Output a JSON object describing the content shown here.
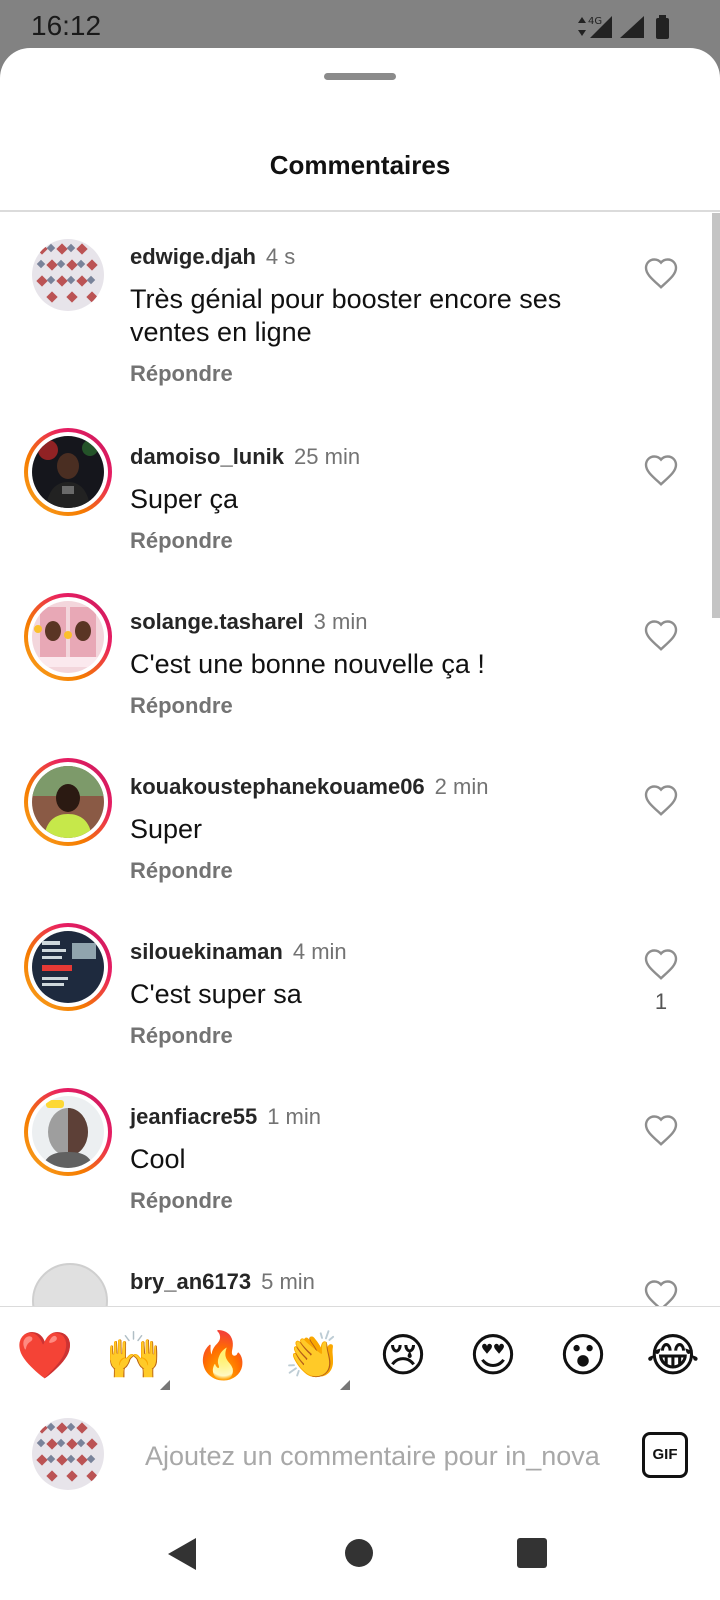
{
  "status_bar": {
    "time": "16:12",
    "network": "4G"
  },
  "sheet": {
    "title": "Commentaires"
  },
  "comments": [
    {
      "username": "edwige.djah",
      "time": "4 s",
      "text": "Très génial pour booster encore ses ventes en ligne",
      "reply": "Répondre",
      "likes": ""
    },
    {
      "username": "damoiso_lunik",
      "time": "25 min",
      "text": "Super ça",
      "reply": "Répondre",
      "likes": ""
    },
    {
      "username": "solange.tasharel",
      "time": "3 min",
      "text": "C'est une bonne nouvelle ça !",
      "reply": "Répondre",
      "likes": ""
    },
    {
      "username": "kouakoustephanekouame06",
      "time": "2 min",
      "text": "Super",
      "reply": "Répondre",
      "likes": ""
    },
    {
      "username": "silouekinaman",
      "time": "4 min",
      "text": "C'est super sa",
      "reply": "Répondre",
      "likes": "1"
    },
    {
      "username": "jeanfiacre55",
      "time": "1 min",
      "text": "Cool",
      "reply": "Répondre",
      "likes": ""
    },
    {
      "username": "bry_an6173",
      "time": "5 min",
      "text": "",
      "reply": "",
      "likes": ""
    }
  ],
  "emoji_bar": {
    "emojis": [
      "❤️",
      "🙌",
      "🔥",
      "👏",
      "😢",
      "😍",
      "😮",
      "😂"
    ]
  },
  "composer": {
    "placeholder": "Ajoutez un commentaire pour in_nova",
    "gif_label": "GIF"
  },
  "colors": {
    "story_ring_start": "#f9a825",
    "story_ring_end": "#c2185b",
    "secondary_text": "#737373"
  }
}
